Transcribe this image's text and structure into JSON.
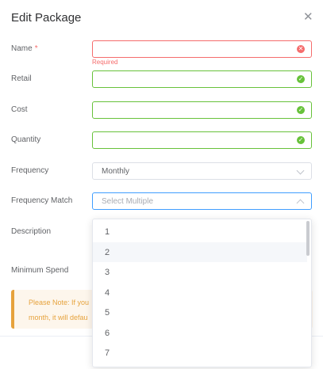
{
  "dialog": {
    "title": "Edit Package",
    "close_icon": "close-icon"
  },
  "form": {
    "name": {
      "label": "Name",
      "required_mark": "*",
      "value": "",
      "error": "Required",
      "status_icon": "error-circle-icon"
    },
    "retail": {
      "label": "Retail",
      "value": "",
      "status_icon": "check-circle-icon"
    },
    "cost": {
      "label": "Cost",
      "value": "",
      "status_icon": "check-circle-icon"
    },
    "quantity": {
      "label": "Quantity",
      "value": "",
      "status_icon": "check-circle-icon"
    },
    "frequency": {
      "label": "Frequency",
      "value": "Monthly",
      "icon": "chevron-down-icon"
    },
    "frequency_match": {
      "label": "Frequency Match",
      "placeholder": "Select Multiple",
      "icon": "chevron-up-icon"
    },
    "description": {
      "label": "Description"
    },
    "minimum_spend": {
      "label": "Minimum Spend"
    }
  },
  "note": {
    "line1": "Please Note: If you",
    "line2": "month, it will defau"
  },
  "dropdown": {
    "options": [
      "1",
      "2",
      "3",
      "4",
      "5",
      "6",
      "7"
    ],
    "hovered": "2"
  },
  "colors": {
    "success": "#67c23a",
    "error": "#f56c6c",
    "warning": "#e6a23c",
    "focus": "#409eff"
  }
}
